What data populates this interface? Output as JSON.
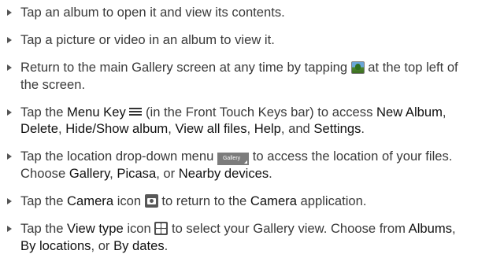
{
  "bullets": [
    {
      "t1": "Tap an album to open it and view its contents."
    },
    {
      "t1": "Tap a picture or video in an album to view it."
    },
    {
      "t1": "Return to the main Gallery screen at any time by tapping ",
      "icon": "gallery-app-icon",
      "t2": " at the top left of the screen."
    },
    {
      "t1": "Tap the ",
      "k1": "Menu Key",
      "icon": "menu-key-icon",
      "t2": " (in the Front Touch Keys bar) to access ",
      "k2": "New Album",
      "s1": ", ",
      "k3": "Delete",
      "s2": ", ",
      "k4": "Hide/Show album",
      "s3": ", ",
      "k5": "View all files",
      "s4": ", ",
      "k6": "Help",
      "s5": ", and ",
      "k7": "Settings",
      "s6": "."
    },
    {
      "t1": "Tap the location drop-down menu ",
      "chip": "Gallery",
      "t2": " to access the location of your files. Choose ",
      "k1": "Gallery",
      "s1": ", ",
      "k2": "Picasa",
      "s2": ", or ",
      "k3": "Nearby devices",
      "s3": "."
    },
    {
      "t1": "Tap the ",
      "k1": "Camera",
      "t2": " icon ",
      "icon": "camera-icon",
      "t3": " to return to the ",
      "k2": "Camera",
      "t4": " application."
    },
    {
      "t1": "Tap the ",
      "k1": "View type",
      "t2": " icon ",
      "icon": "view-type-icon",
      "t3": " to select your Gallery view. Choose from ",
      "k2": "Albums",
      "s1": ", ",
      "k3": "By locations",
      "s2": ", or ",
      "k4": "By dates",
      "s3": "."
    }
  ],
  "colors": {
    "body_text": "#3a3a3a",
    "keyword_text": "#111111",
    "bullet": "#555555"
  }
}
